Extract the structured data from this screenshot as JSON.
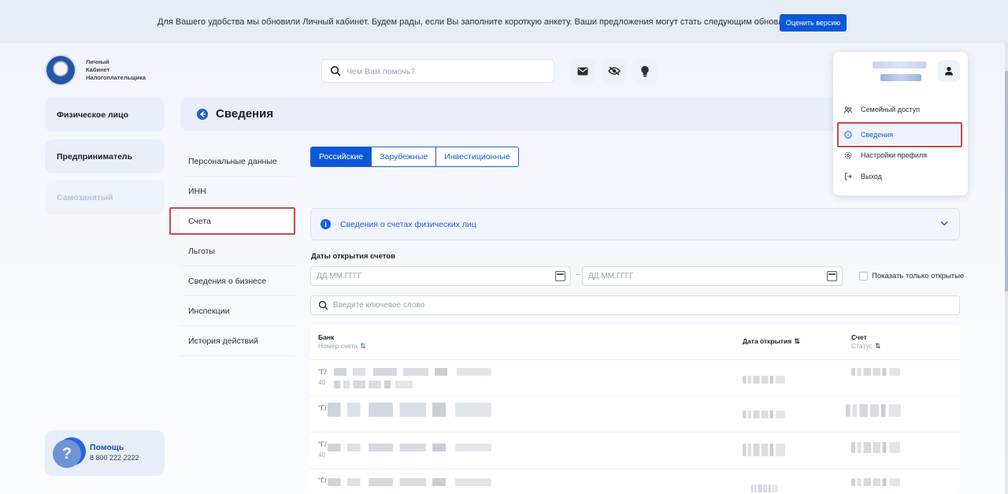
{
  "banner": {
    "text": "Для Вашего удобства мы обновили Личный кабинет. Будем рады, если Вы заполните короткую анкету. Ваши предложения могут стать следующим обновлением",
    "button": "Оценить версию"
  },
  "logo": {
    "line1": "Личный",
    "line2": "Кабинет",
    "line3": "Налогоплательщика"
  },
  "search": {
    "placeholder": "Чем Вам помочь?"
  },
  "header_icons": [
    "mail-icon",
    "eye-off-icon",
    "lightbulb-icon"
  ],
  "left_nav": [
    {
      "label": "Физическое лицо",
      "state": "active"
    },
    {
      "label": "Предприниматель",
      "state": "normal"
    },
    {
      "label": "Самозанятый",
      "state": "disabled"
    }
  ],
  "help": {
    "title": "Помощь",
    "phone": "8 800 222 2222"
  },
  "page": {
    "title": "Сведения"
  },
  "subnav": [
    "Персональные данные",
    "ИНН",
    "Счета",
    "Льготы",
    "Сведения о бизнесе",
    "Инспекции",
    "История действий"
  ],
  "subnav_active": "Счета",
  "tabs": [
    {
      "label": "Российские",
      "active": true
    },
    {
      "label": "Зарубежные",
      "active": false
    },
    {
      "label": "Инвестиционные",
      "active": false
    }
  ],
  "info_panel": {
    "text": "Сведения о счетах физических лиц"
  },
  "filters": {
    "dates_label": "Даты открытия счетов",
    "date_from_placeholder": "ДД.ММ.ГГГГ",
    "date_to_placeholder": "ДД.ММ.ГГГГ",
    "separator": "–",
    "only_open_label": "Показать только открытые",
    "keyword_placeholder": "Введите ключевое слово"
  },
  "table": {
    "col_bank": "Банк",
    "col_bank_sub": "Номер счета",
    "col_date": "Дата открытия",
    "col_account": "Счет",
    "col_account_sub": "Статус",
    "rows": [
      {
        "lead": "\"Г/",
        "lead2": "40"
      },
      {
        "lead": "\"Г/",
        "lead2": ""
      },
      {
        "lead": "\"Г/",
        "lead2": "40"
      },
      {
        "lead": "\"Г/",
        "lead2": ""
      }
    ]
  },
  "profile_menu": {
    "items": [
      {
        "label": "Семейный доступ",
        "icon": "family-icon"
      },
      {
        "label": "Сведения",
        "icon": "info-icon",
        "selected": true
      },
      {
        "label": "Настройки профиля",
        "icon": "settings-icon"
      },
      {
        "label": "Выход",
        "icon": "logout-icon"
      }
    ]
  },
  "colors": {
    "accent": "#0a58d8",
    "highlight_border": "#c84a4a",
    "panel_bg": "#e9eef9"
  }
}
